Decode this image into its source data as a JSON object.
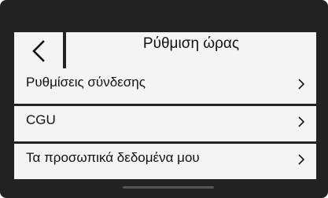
{
  "header": {
    "title": "Ρύθμιση ώρας",
    "back_icon": "chevron-left-icon"
  },
  "menu": {
    "items": [
      {
        "label": "Ρυθμίσεις σύνδεσης",
        "icon": "chevron-right-icon"
      },
      {
        "label": "CGU",
        "icon": "chevron-right-icon"
      },
      {
        "label": "Τα προσωπικά δεδομένα μου",
        "icon": "chevron-right-icon"
      }
    ]
  },
  "colors": {
    "background": "#222222",
    "panel": "#f4f4f4",
    "text": "#111111",
    "scroll_indicator": "#555555"
  }
}
